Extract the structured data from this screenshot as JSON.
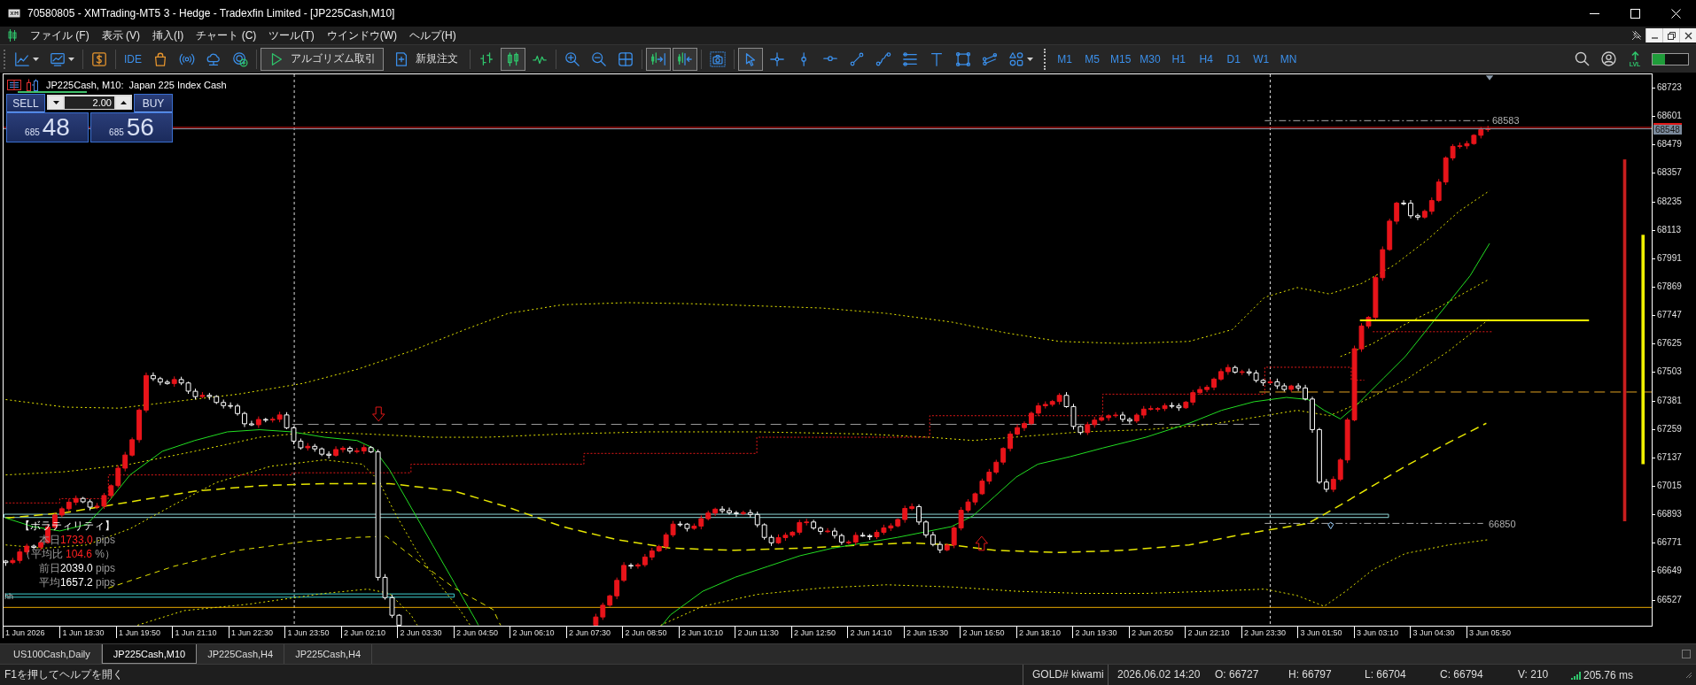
{
  "window": {
    "title": "70580805 - XMTrading-MT5 3 - Hedge - Tradexfin Limited - [JP225Cash,M10]"
  },
  "menu": {
    "items": [
      "ファイル (F)",
      "表示 (V)",
      "挿入(I)",
      "チャート (C)",
      "ツール(T)",
      "ウインドウ(W)",
      "ヘルプ(H)"
    ]
  },
  "toolbar": {
    "groups": [
      [
        {
          "kind": "line-chart",
          "dropdown": true,
          "selected": false
        },
        {
          "kind": "template",
          "dropdown": true,
          "selected": false
        }
      ],
      [
        {
          "kind": "dollar",
          "selected": false
        }
      ],
      [
        {
          "kind": "ide",
          "label": "IDE",
          "selected": false
        },
        {
          "kind": "bag",
          "selected": false
        },
        {
          "kind": "signals",
          "selected": false
        },
        {
          "kind": "cloud",
          "selected": false
        },
        {
          "kind": "vps",
          "selected": false
        }
      ],
      [
        {
          "kind": "algo-trading",
          "label": "アルゴリズム取引",
          "selected": true
        },
        {
          "kind": "new-order",
          "label": "新規注文",
          "selected": false
        }
      ],
      [
        {
          "kind": "bars",
          "selected": false
        },
        {
          "kind": "candles",
          "selected": true
        },
        {
          "kind": "line",
          "selected": false
        }
      ],
      [
        {
          "kind": "zoom-in",
          "selected": false
        },
        {
          "kind": "zoom-out",
          "selected": false
        },
        {
          "kind": "tile",
          "selected": false
        }
      ],
      [
        {
          "kind": "autoscroll",
          "selected": true
        },
        {
          "kind": "chart-shift",
          "selected": true
        }
      ],
      [
        {
          "kind": "screenshot",
          "selected": false
        }
      ],
      [
        {
          "kind": "cursor",
          "selected": true
        },
        {
          "kind": "crosshair",
          "selected": false
        },
        {
          "kind": "vertical-line",
          "selected": false
        },
        {
          "kind": "horizontal-line",
          "selected": false
        },
        {
          "kind": "trend-line",
          "selected": false
        },
        {
          "kind": "channel",
          "selected": false
        },
        {
          "kind": "fibonacci",
          "selected": false
        },
        {
          "kind": "text",
          "selected": false
        },
        {
          "kind": "rectangle",
          "selected": false
        },
        {
          "kind": "pitchfork",
          "selected": false
        },
        {
          "kind": "shapes",
          "dropdown": true,
          "selected": false
        }
      ]
    ],
    "timeframes": [
      "M1",
      "M5",
      "M15",
      "M30",
      "H1",
      "H4",
      "D1",
      "W1",
      "MN"
    ],
    "lvl_label": "LVL",
    "meter": {
      "level": 0.34
    }
  },
  "chart": {
    "title": "JP225Cash, M10:  Japan 225 Index Cash",
    "trade_panel": {
      "sell": {
        "label": "SELL",
        "price_head": "685",
        "price_tail": "48"
      },
      "volume": "2.00",
      "buy": {
        "label": "BUY",
        "price_head": "685",
        "price_tail": "56"
      }
    },
    "volatility": {
      "title": "【ボラティリティ】",
      "lines": [
        {
          "label": "本日",
          "value": "1733.0",
          "unit": " pips",
          "highlight": true
        },
        {
          "label": "（平均比 ",
          "value": "104.6",
          "unit": " %）",
          "highlight": true
        },
        {
          "label": "前日",
          "value": "2039.0",
          "unit": " pips",
          "highlight": false
        },
        {
          "label": "平均",
          "value": "1657.2",
          "unit": " pips",
          "highlight": false
        }
      ]
    },
    "edge_label": "hh",
    "level_labels": [
      "68583",
      "66850"
    ],
    "price_axis": {
      "labels": [
        "68723",
        "68601",
        "68479",
        "68357",
        "68235",
        "68113",
        "67991",
        "67869",
        "67747",
        "67625",
        "67503",
        "67381",
        "67259",
        "67137",
        "67015",
        "66893",
        "66771",
        "66649",
        "66527"
      ],
      "current": "68548"
    },
    "time_axis": {
      "labels": [
        "1 Jun 2026",
        "1 Jun 18:30",
        "1 Jun 19:50",
        "1 Jun 21:10",
        "1 Jun 22:30",
        "1 Jun 23:50",
        "2 Jun 02:10",
        "2 Jun 03:30",
        "2 Jun 04:50",
        "2 Jun 06:10",
        "2 Jun 07:30",
        "2 Jun 08:50",
        "2 Jun 10:10",
        "2 Jun 11:30",
        "2 Jun 12:50",
        "2 Jun 14:10",
        "2 Jun 15:30",
        "2 Jun 16:50",
        "2 Jun 18:10",
        "2 Jun 19:30",
        "2 Jun 20:50",
        "2 Jun 22:10",
        "2 Jun 23:30",
        "3 Jun 01:50",
        "3 Jun 03:10",
        "3 Jun 04:30",
        "3 Jun 05:50"
      ]
    }
  },
  "tabs": [
    {
      "label": "US100Cash,Daily",
      "selected": false
    },
    {
      "label": "JP225Cash,M10",
      "selected": true
    },
    {
      "label": "JP225Cash,H4",
      "selected": false
    },
    {
      "label": "JP225Cash,H4",
      "selected": false
    }
  ],
  "status_bar": {
    "help": "F1を押してヘルプを開く",
    "profile": "GOLD# kiwami",
    "time": "2026.06.02 14:20",
    "open": "O: 66727",
    "high": "H: 66797",
    "low": "L: 66704",
    "close": "C: 66794",
    "volume": "V: 210",
    "ping": "205.76 ms"
  }
}
